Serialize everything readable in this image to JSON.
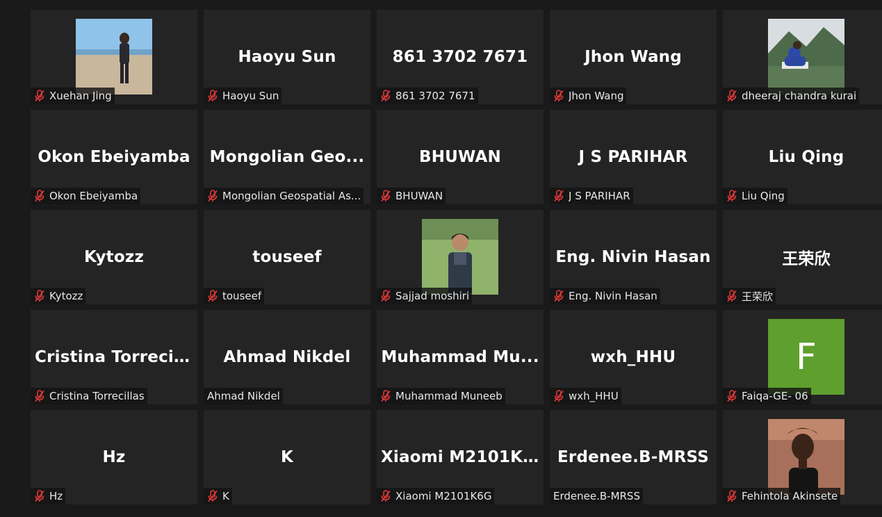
{
  "colors": {
    "background": "#1a1a1a",
    "tile": "#242424",
    "muted_mic": "#e0393a",
    "avatar_green": "#5e9f2e"
  },
  "participants": [
    {
      "label": "Xuehan Jing",
      "big_name": "",
      "muted": true,
      "visual": "photo",
      "photo_kind": "beach"
    },
    {
      "label": "Haoyu Sun",
      "big_name": "Haoyu Sun",
      "muted": true,
      "visual": "name"
    },
    {
      "label": "861 3702 7671",
      "big_name": "861 3702 7671",
      "muted": true,
      "visual": "name"
    },
    {
      "label": "Jhon Wang",
      "big_name": "Jhon Wang",
      "muted": true,
      "visual": "name"
    },
    {
      "label": "dheeraj chandra kurai",
      "big_name": "",
      "muted": true,
      "visual": "photo",
      "photo_kind": "mountain"
    },
    {
      "label": "Okon Ebeiyamba",
      "big_name": "Okon Ebeiyamba",
      "muted": true,
      "visual": "name"
    },
    {
      "label": "Mongolian Geospatial As...",
      "big_name": "Mongolian  Geo...",
      "muted": true,
      "visual": "name"
    },
    {
      "label": "BHUWAN",
      "big_name": "BHUWAN",
      "muted": true,
      "visual": "name"
    },
    {
      "label": "J S PARIHAR",
      "big_name": "J S PARIHAR",
      "muted": true,
      "visual": "name"
    },
    {
      "label": "Liu Qing",
      "big_name": "Liu Qing",
      "muted": true,
      "visual": "name"
    },
    {
      "label": "Kytozz",
      "big_name": "Kytozz",
      "muted": true,
      "visual": "name"
    },
    {
      "label": "touseef",
      "big_name": "touseef",
      "muted": true,
      "visual": "name"
    },
    {
      "label": "Sajjad moshiri",
      "big_name": "",
      "muted": true,
      "visual": "photo",
      "photo_kind": "field"
    },
    {
      "label": "Eng. Nivin Hasan",
      "big_name": "Eng. Nivin Hasan",
      "muted": true,
      "visual": "name"
    },
    {
      "label": "王荣欣",
      "big_name": "王荣欣",
      "muted": true,
      "visual": "name"
    },
    {
      "label": "Cristina Torrecillas",
      "big_name": "Cristina  Torrecil...",
      "muted": true,
      "visual": "name"
    },
    {
      "label": "Ahmad Nikdel",
      "big_name": "Ahmad Nikdel",
      "muted": false,
      "visual": "name"
    },
    {
      "label": "Muhammad Muneeb",
      "big_name": "Muhammad  Mu...",
      "muted": true,
      "visual": "name"
    },
    {
      "label": "wxh_HHU",
      "big_name": "wxh_HHU",
      "muted": true,
      "visual": "name"
    },
    {
      "label": "Faiqa-GE- 06",
      "big_name": "",
      "muted": true,
      "visual": "avatar",
      "avatar_letter": "F"
    },
    {
      "label": "Hz",
      "big_name": "Hz",
      "muted": true,
      "visual": "name"
    },
    {
      "label": "K",
      "big_name": "K",
      "muted": true,
      "visual": "name"
    },
    {
      "label": "Xiaomi M2101K6G",
      "big_name": "Xiaomi  M2101K...",
      "muted": true,
      "visual": "name"
    },
    {
      "label": "Erdenee.B-MRSS",
      "big_name": "Erdenee.B-MRSS",
      "muted": false,
      "visual": "name"
    },
    {
      "label": "Fehintola Akinsete",
      "big_name": "",
      "muted": true,
      "visual": "photo",
      "photo_kind": "portrait"
    }
  ]
}
